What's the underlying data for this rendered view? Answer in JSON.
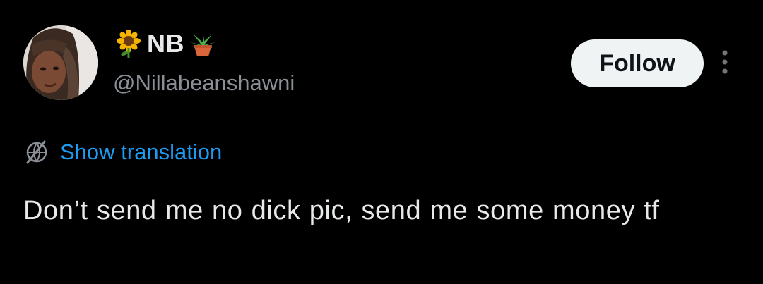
{
  "tweet": {
    "author": {
      "display_name": "NB",
      "handle": "@Nillabeanshawni",
      "avatar_alt": "profile photo",
      "name_emojis": [
        "sunflower-emoji",
        "potted-plant-emoji"
      ]
    },
    "follow_label": "Follow",
    "more_icon": "more-vertical-icon",
    "translation": {
      "icon": "translate-globe-icon",
      "label": "Show translation"
    },
    "text": "Don’t send me no dick pic, send me some money tf"
  },
  "colors": {
    "background": "#000000",
    "text": "#e7e9ea",
    "secondary_text": "#8b9096",
    "link": "#1d9bf0",
    "follow_button_bg": "#eff3f4",
    "follow_button_text": "#0f1419"
  }
}
